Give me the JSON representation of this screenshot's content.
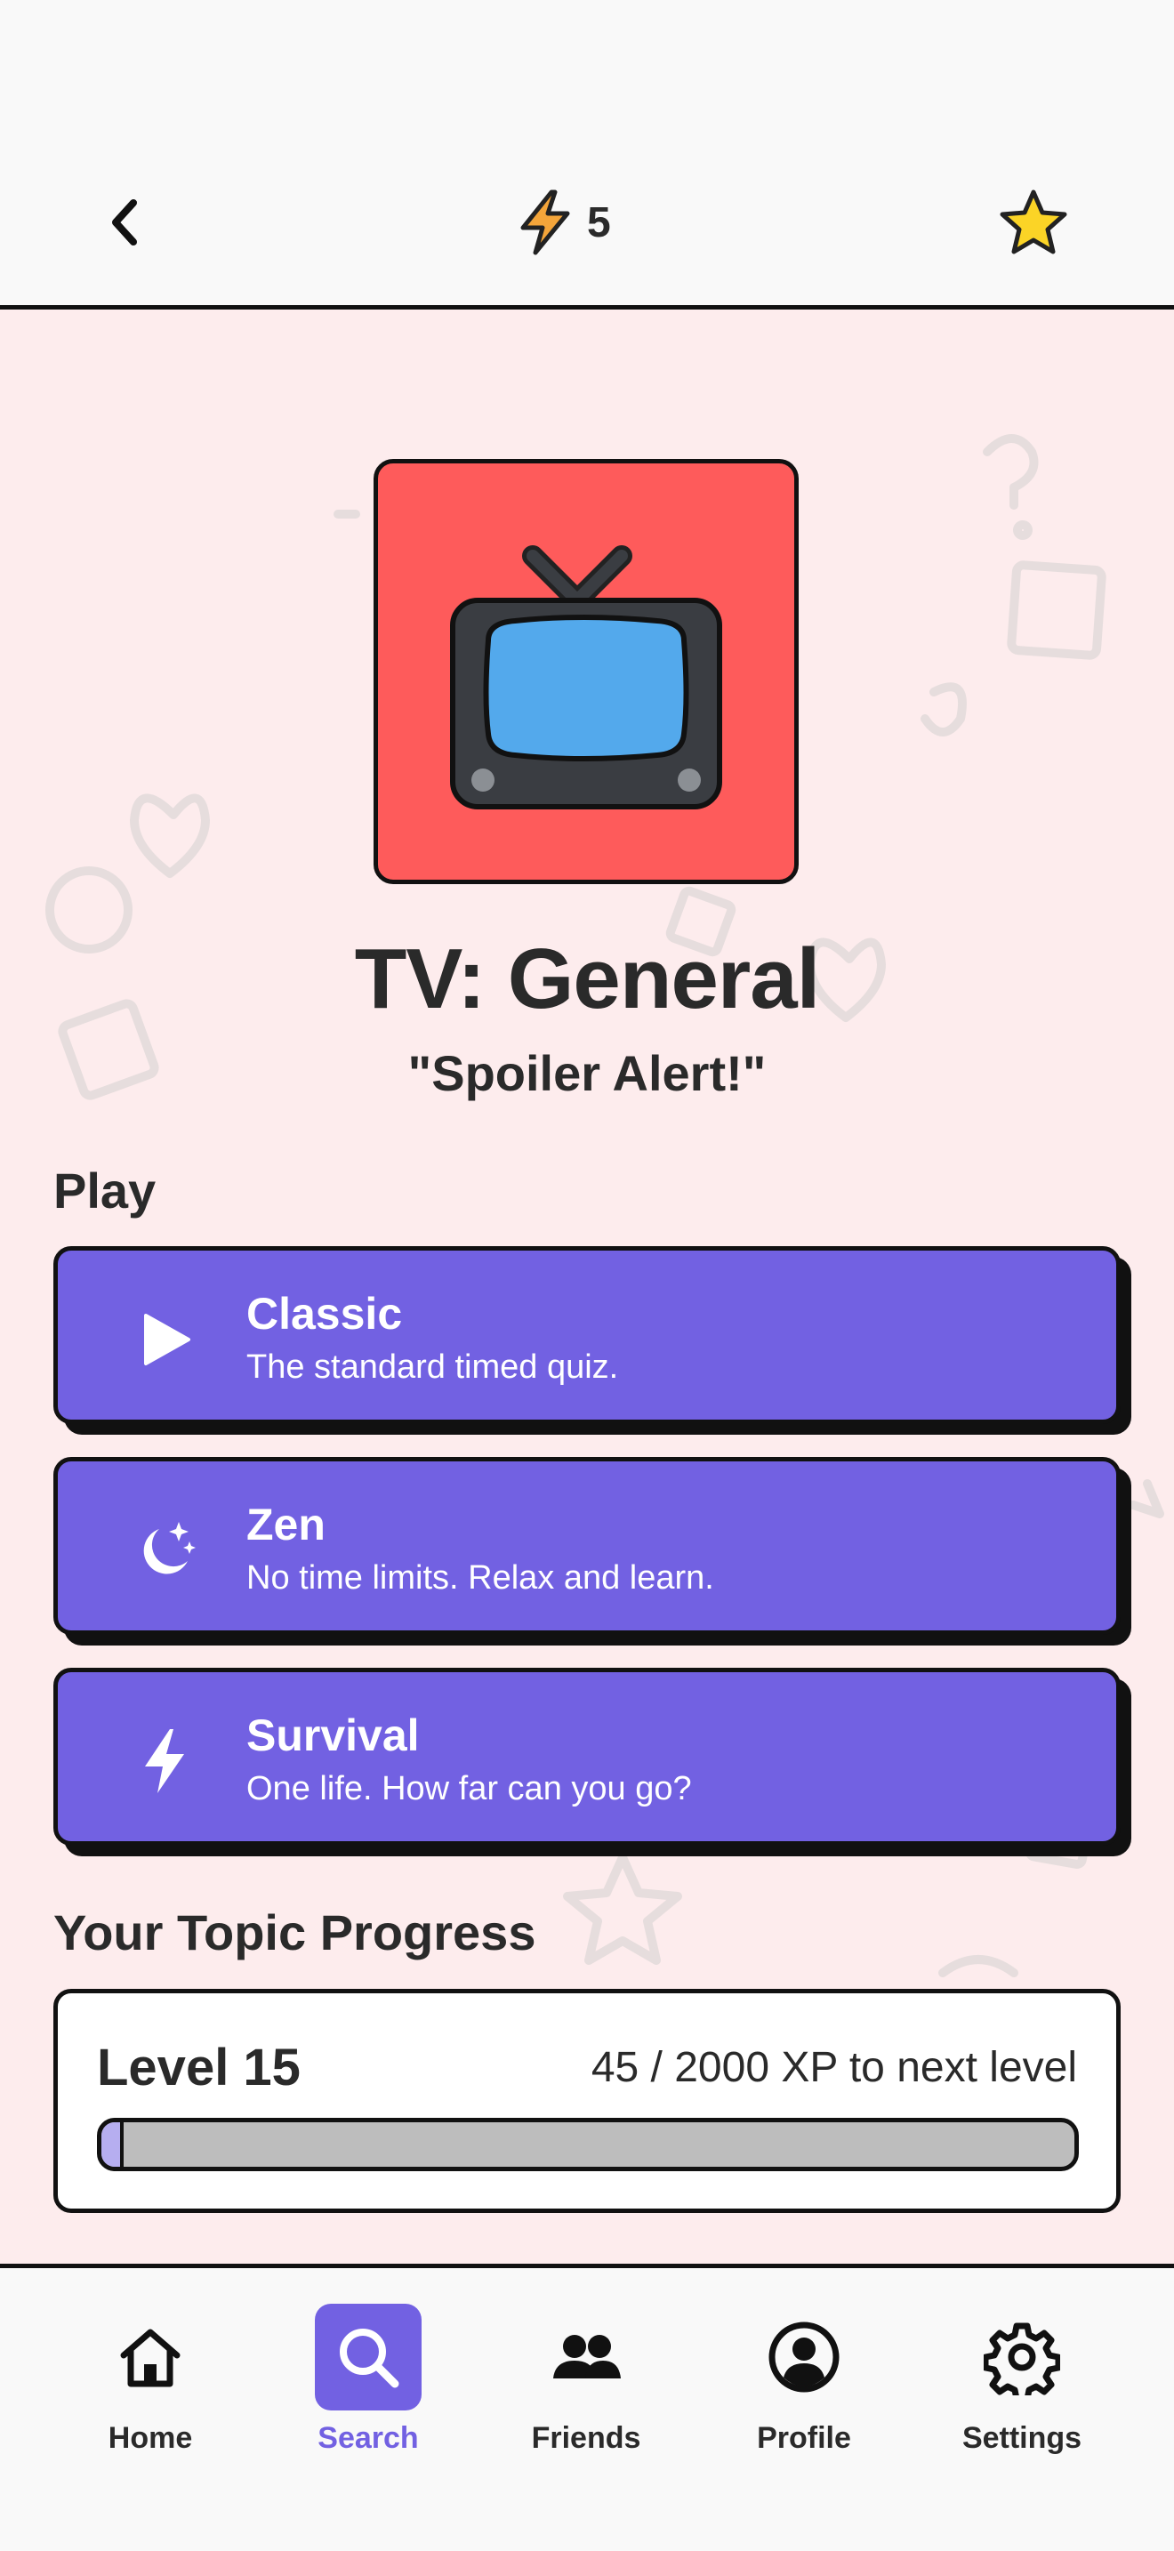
{
  "header": {
    "energy_count": "5"
  },
  "topic": {
    "title": "TV: General",
    "subtitle": "\"Spoiler Alert!\"",
    "tile_color": "#fe5b5b"
  },
  "play": {
    "section_label": "Play",
    "modes": [
      {
        "title": "Classic",
        "description": "The standard timed quiz.",
        "icon": "play-icon"
      },
      {
        "title": "Zen",
        "description": "No time limits. Relax and learn.",
        "icon": "moon-stars-icon"
      },
      {
        "title": "Survival",
        "description": "One life. How far can you go?",
        "icon": "lightning-icon"
      }
    ],
    "accent_color": "#7261e2"
  },
  "progress": {
    "section_label": "Your Topic Progress",
    "level_label": "Level 15",
    "xp_label": "45 / 2000 XP to next level",
    "xp_current": 45,
    "xp_max": 2000
  },
  "nav": {
    "items": [
      {
        "label": "Home",
        "icon": "home-icon",
        "active": false
      },
      {
        "label": "Search",
        "icon": "search-icon",
        "active": true
      },
      {
        "label": "Friends",
        "icon": "friends-icon",
        "active": false
      },
      {
        "label": "Profile",
        "icon": "profile-icon",
        "active": false
      },
      {
        "label": "Settings",
        "icon": "gear-icon",
        "active": false
      }
    ]
  }
}
